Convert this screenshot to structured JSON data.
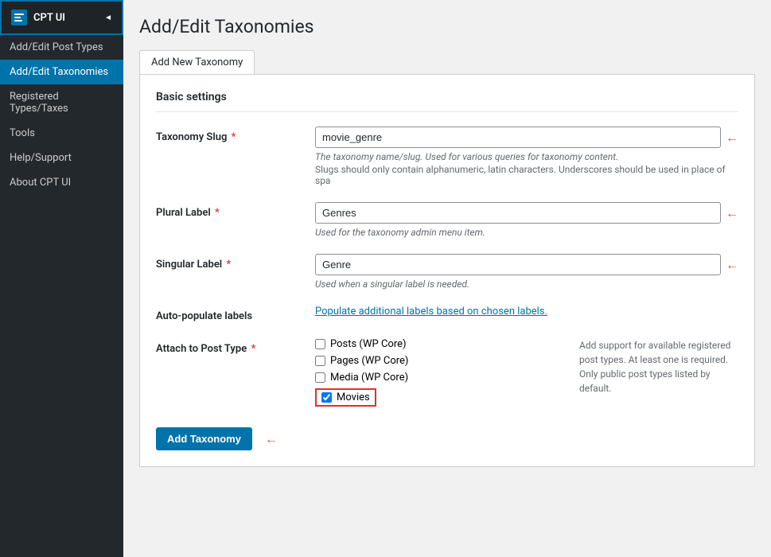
{
  "sidebar": {
    "logo_text": "CPT UI",
    "logo_icon": "≡",
    "arrow": "◄",
    "items": [
      {
        "id": "add-edit-post-types",
        "label": "Add/Edit Post Types",
        "active": false
      },
      {
        "id": "add-edit-taxonomies",
        "label": "Add/Edit Taxonomies",
        "active": true
      },
      {
        "id": "registered-types-taxes",
        "label": "Registered Types/Taxes",
        "active": false
      },
      {
        "id": "tools",
        "label": "Tools",
        "active": false
      },
      {
        "id": "help-support",
        "label": "Help/Support",
        "active": false
      },
      {
        "id": "about-cpt-ui",
        "label": "About CPT UI",
        "active": false
      }
    ]
  },
  "page": {
    "title": "Add/Edit Taxonomies"
  },
  "tabs": [
    {
      "id": "add-new",
      "label": "Add New Taxonomy",
      "active": true
    }
  ],
  "form": {
    "section_title": "Basic settings",
    "fields": {
      "taxonomy_slug": {
        "label": "Taxonomy Slug",
        "required": true,
        "value": "movie_genre",
        "help_italic": "The taxonomy name/slug. Used for various queries for taxonomy content.",
        "help_normal": "Slugs should only contain alphanumeric, latin characters. Underscores should be used in place of spa"
      },
      "plural_label": {
        "label": "Plural Label",
        "required": true,
        "value": "Genres",
        "help_italic": "Used for the taxonomy admin menu item."
      },
      "singular_label": {
        "label": "Singular Label",
        "required": true,
        "value": "Genre",
        "help_italic": "Used when a singular label is needed."
      },
      "auto_populate_labels": {
        "label": "Auto-populate labels",
        "link_text": "Populate additional labels based on chosen labels."
      },
      "attach_to_post_type": {
        "label": "Attach to Post Type",
        "required": true,
        "description": "Add support for available registered post types. At least one is required. Only public post types listed by default.",
        "checkboxes": [
          {
            "id": "posts",
            "label": "Posts (WP Core)",
            "checked": false
          },
          {
            "id": "pages",
            "label": "Pages (WP Core)",
            "checked": false
          },
          {
            "id": "media",
            "label": "Media (WP Core)",
            "checked": false
          },
          {
            "id": "movies",
            "label": "Movies",
            "checked": true
          }
        ]
      }
    },
    "add_button_label": "Add Taxonomy"
  },
  "annotations": {
    "arrow": "←"
  }
}
